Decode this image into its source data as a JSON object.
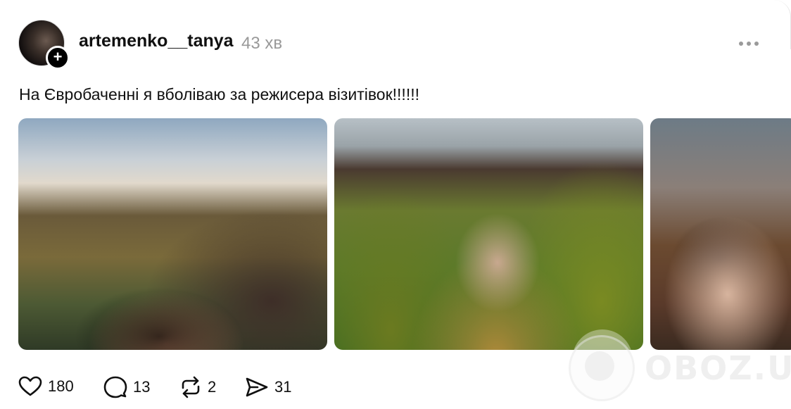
{
  "post": {
    "username": "artemenko__tanya",
    "timestamp": "43 хв",
    "text": "На Євробаченні я вболіваю за режисера візитівок!!!!!!",
    "follow_symbol": "+"
  },
  "media": {
    "images": [
      "image-1",
      "image-2",
      "image-3"
    ]
  },
  "actions": {
    "likes": "180",
    "comments": "13",
    "reposts": "2",
    "shares": "31"
  },
  "watermark": {
    "text": "OBOZ.UA"
  },
  "icons": {
    "like": "heart-icon",
    "comment": "comment-bubble-icon",
    "repost": "repost-icon",
    "share": "send-icon",
    "more": "more-dots-icon"
  }
}
